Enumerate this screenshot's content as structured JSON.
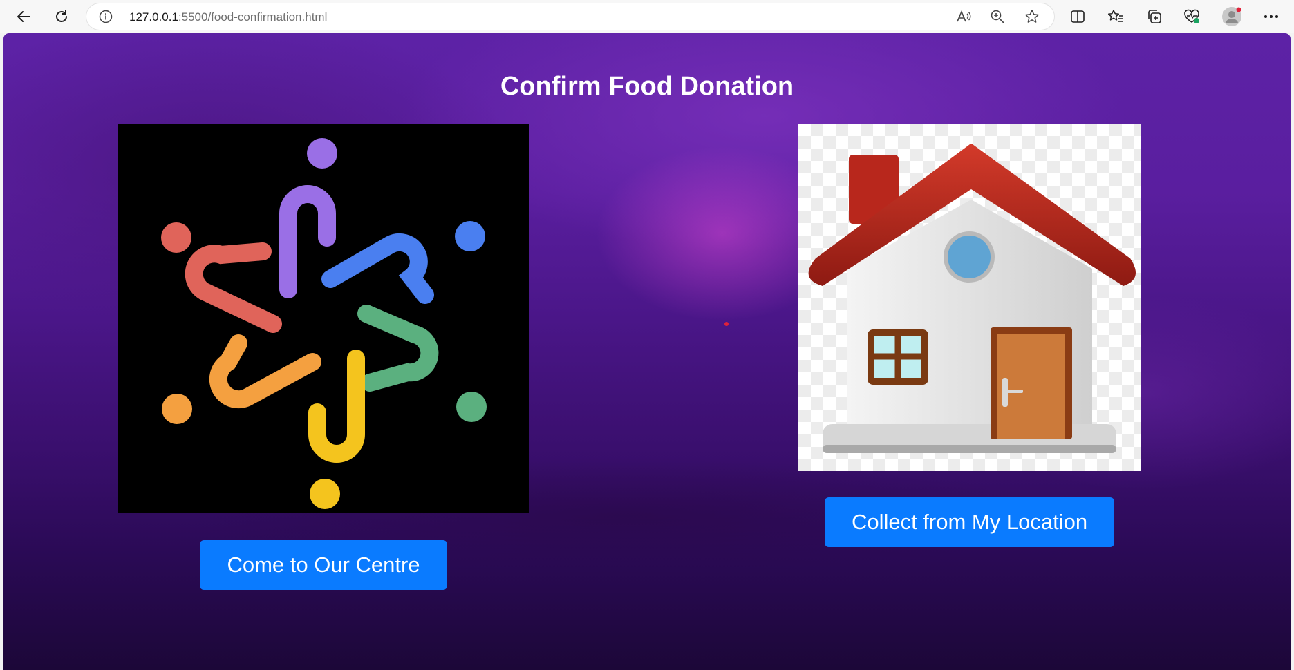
{
  "browser": {
    "url_host": "127.0.0.1",
    "url_rest": ":5500/food-confirmation.html",
    "icons": [
      "back-icon",
      "refresh-icon",
      "site-info-icon",
      "read-aloud-icon",
      "zoom-icon",
      "favorite-star-icon",
      "split-screen-icon",
      "favorites-icon",
      "collections-icon",
      "browser-essentials-icon",
      "profile-icon",
      "more-menu-icon"
    ]
  },
  "page": {
    "title": "Confirm Food Donation",
    "options": [
      {
        "image": "community-people-logo",
        "button_label": "Come to Our Centre"
      },
      {
        "image": "house-icon",
        "button_label": "Collect from My Location"
      }
    ]
  },
  "colors": {
    "button": "#0a7bff",
    "button_text": "#ffffff",
    "title_text": "#ffffff",
    "background_top": "#5d22a6",
    "background_bottom": "#1c0738"
  }
}
